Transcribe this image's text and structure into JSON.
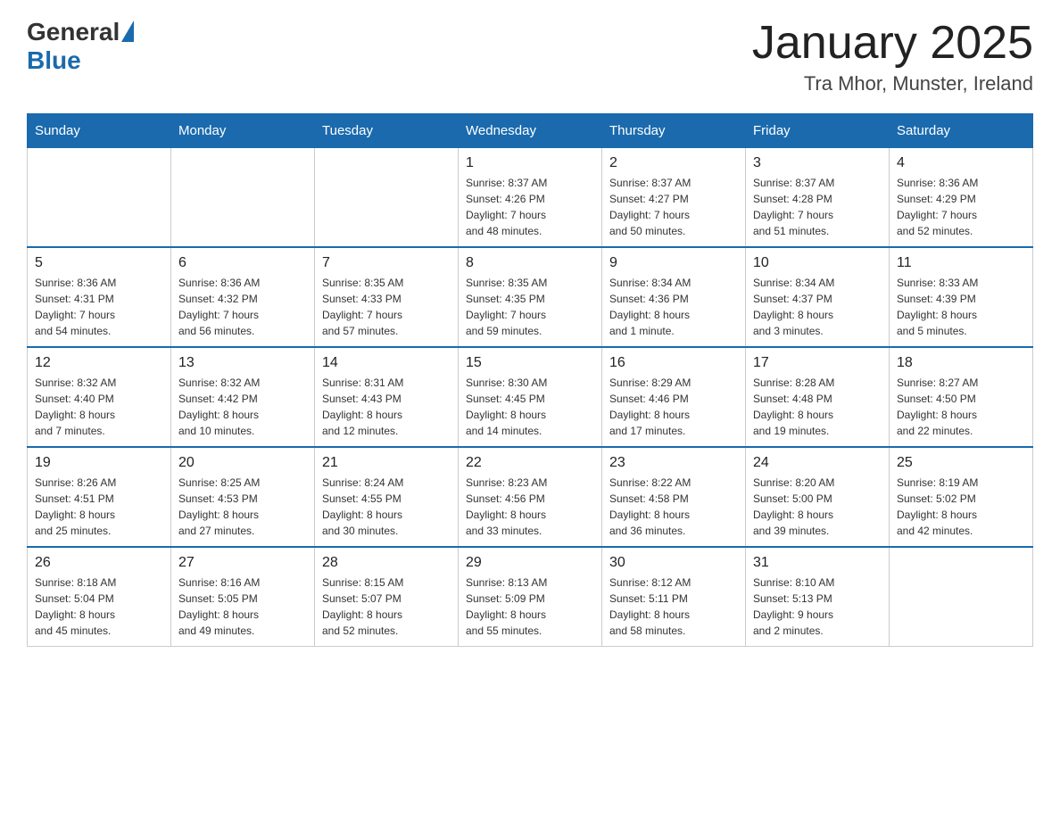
{
  "header": {
    "logo_general": "General",
    "logo_blue": "Blue",
    "month_title": "January 2025",
    "location": "Tra Mhor, Munster, Ireland"
  },
  "days_of_week": [
    "Sunday",
    "Monday",
    "Tuesday",
    "Wednesday",
    "Thursday",
    "Friday",
    "Saturday"
  ],
  "weeks": [
    [
      {
        "day": "",
        "info": ""
      },
      {
        "day": "",
        "info": ""
      },
      {
        "day": "",
        "info": ""
      },
      {
        "day": "1",
        "info": "Sunrise: 8:37 AM\nSunset: 4:26 PM\nDaylight: 7 hours\nand 48 minutes."
      },
      {
        "day": "2",
        "info": "Sunrise: 8:37 AM\nSunset: 4:27 PM\nDaylight: 7 hours\nand 50 minutes."
      },
      {
        "day": "3",
        "info": "Sunrise: 8:37 AM\nSunset: 4:28 PM\nDaylight: 7 hours\nand 51 minutes."
      },
      {
        "day": "4",
        "info": "Sunrise: 8:36 AM\nSunset: 4:29 PM\nDaylight: 7 hours\nand 52 minutes."
      }
    ],
    [
      {
        "day": "5",
        "info": "Sunrise: 8:36 AM\nSunset: 4:31 PM\nDaylight: 7 hours\nand 54 minutes."
      },
      {
        "day": "6",
        "info": "Sunrise: 8:36 AM\nSunset: 4:32 PM\nDaylight: 7 hours\nand 56 minutes."
      },
      {
        "day": "7",
        "info": "Sunrise: 8:35 AM\nSunset: 4:33 PM\nDaylight: 7 hours\nand 57 minutes."
      },
      {
        "day": "8",
        "info": "Sunrise: 8:35 AM\nSunset: 4:35 PM\nDaylight: 7 hours\nand 59 minutes."
      },
      {
        "day": "9",
        "info": "Sunrise: 8:34 AM\nSunset: 4:36 PM\nDaylight: 8 hours\nand 1 minute."
      },
      {
        "day": "10",
        "info": "Sunrise: 8:34 AM\nSunset: 4:37 PM\nDaylight: 8 hours\nand 3 minutes."
      },
      {
        "day": "11",
        "info": "Sunrise: 8:33 AM\nSunset: 4:39 PM\nDaylight: 8 hours\nand 5 minutes."
      }
    ],
    [
      {
        "day": "12",
        "info": "Sunrise: 8:32 AM\nSunset: 4:40 PM\nDaylight: 8 hours\nand 7 minutes."
      },
      {
        "day": "13",
        "info": "Sunrise: 8:32 AM\nSunset: 4:42 PM\nDaylight: 8 hours\nand 10 minutes."
      },
      {
        "day": "14",
        "info": "Sunrise: 8:31 AM\nSunset: 4:43 PM\nDaylight: 8 hours\nand 12 minutes."
      },
      {
        "day": "15",
        "info": "Sunrise: 8:30 AM\nSunset: 4:45 PM\nDaylight: 8 hours\nand 14 minutes."
      },
      {
        "day": "16",
        "info": "Sunrise: 8:29 AM\nSunset: 4:46 PM\nDaylight: 8 hours\nand 17 minutes."
      },
      {
        "day": "17",
        "info": "Sunrise: 8:28 AM\nSunset: 4:48 PM\nDaylight: 8 hours\nand 19 minutes."
      },
      {
        "day": "18",
        "info": "Sunrise: 8:27 AM\nSunset: 4:50 PM\nDaylight: 8 hours\nand 22 minutes."
      }
    ],
    [
      {
        "day": "19",
        "info": "Sunrise: 8:26 AM\nSunset: 4:51 PM\nDaylight: 8 hours\nand 25 minutes."
      },
      {
        "day": "20",
        "info": "Sunrise: 8:25 AM\nSunset: 4:53 PM\nDaylight: 8 hours\nand 27 minutes."
      },
      {
        "day": "21",
        "info": "Sunrise: 8:24 AM\nSunset: 4:55 PM\nDaylight: 8 hours\nand 30 minutes."
      },
      {
        "day": "22",
        "info": "Sunrise: 8:23 AM\nSunset: 4:56 PM\nDaylight: 8 hours\nand 33 minutes."
      },
      {
        "day": "23",
        "info": "Sunrise: 8:22 AM\nSunset: 4:58 PM\nDaylight: 8 hours\nand 36 minutes."
      },
      {
        "day": "24",
        "info": "Sunrise: 8:20 AM\nSunset: 5:00 PM\nDaylight: 8 hours\nand 39 minutes."
      },
      {
        "day": "25",
        "info": "Sunrise: 8:19 AM\nSunset: 5:02 PM\nDaylight: 8 hours\nand 42 minutes."
      }
    ],
    [
      {
        "day": "26",
        "info": "Sunrise: 8:18 AM\nSunset: 5:04 PM\nDaylight: 8 hours\nand 45 minutes."
      },
      {
        "day": "27",
        "info": "Sunrise: 8:16 AM\nSunset: 5:05 PM\nDaylight: 8 hours\nand 49 minutes."
      },
      {
        "day": "28",
        "info": "Sunrise: 8:15 AM\nSunset: 5:07 PM\nDaylight: 8 hours\nand 52 minutes."
      },
      {
        "day": "29",
        "info": "Sunrise: 8:13 AM\nSunset: 5:09 PM\nDaylight: 8 hours\nand 55 minutes."
      },
      {
        "day": "30",
        "info": "Sunrise: 8:12 AM\nSunset: 5:11 PM\nDaylight: 8 hours\nand 58 minutes."
      },
      {
        "day": "31",
        "info": "Sunrise: 8:10 AM\nSunset: 5:13 PM\nDaylight: 9 hours\nand 2 minutes."
      },
      {
        "day": "",
        "info": ""
      }
    ]
  ]
}
